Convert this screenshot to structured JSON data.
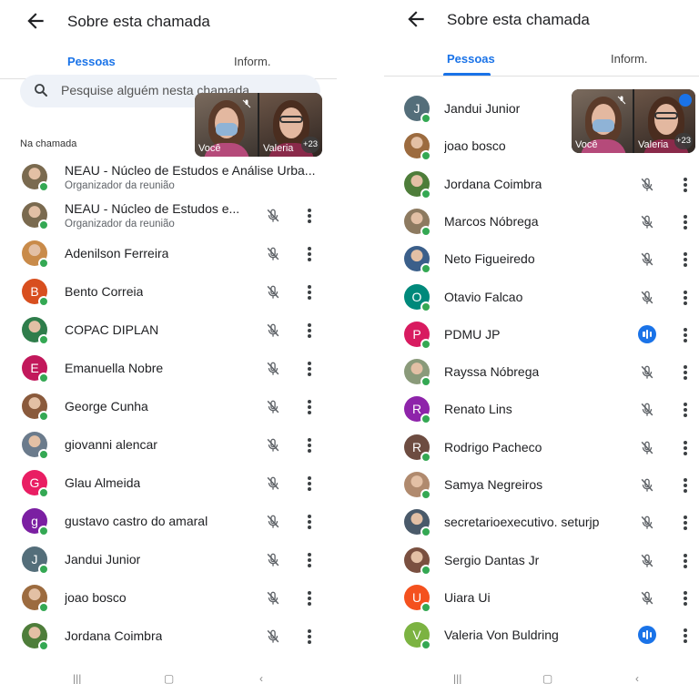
{
  "header": {
    "title": "Sobre esta chamada"
  },
  "tabs": {
    "people": "Pessoas",
    "info": "Inform."
  },
  "search": {
    "placeholder": "Pesquise alguém nesta chamada"
  },
  "section_label": "Na chamada",
  "pip": {
    "you_label": "Você",
    "other_label": "Valeria",
    "extra_count": "+23"
  },
  "left_list": [
    {
      "name": "NEAU - Núcleo de Estudos e Análise Urba...",
      "sub": "Organizador da reunião",
      "avatar": "photo",
      "color": "#7a6a4f",
      "controls": false
    },
    {
      "name": "NEAU - Núcleo de Estudos e...",
      "sub": "Organizador da reunião",
      "avatar": "photo",
      "color": "#7a6a4f",
      "controls": true
    },
    {
      "name": "Adenilson Ferreira",
      "avatar": "photo",
      "color": "#c98b4a",
      "controls": true
    },
    {
      "name": "Bento Correia",
      "avatar": "letter",
      "letter": "B",
      "color": "#d84f1f",
      "controls": true
    },
    {
      "name": "COPAC DIPLAN",
      "avatar": "photo",
      "color": "#2f7d4b",
      "controls": true
    },
    {
      "name": "Emanuella Nobre",
      "avatar": "letter",
      "letter": "E",
      "color": "#c2185b",
      "controls": true
    },
    {
      "name": "George Cunha",
      "avatar": "photo",
      "color": "#8a5a3c",
      "controls": true
    },
    {
      "name": "giovanni alencar",
      "avatar": "photo",
      "color": "#6b7b8c",
      "controls": true
    },
    {
      "name": "Glau Almeida",
      "avatar": "letter",
      "letter": "G",
      "color": "#e91e63",
      "controls": true
    },
    {
      "name": "gustavo castro do amaral",
      "avatar": "letter",
      "letter": "g",
      "color": "#7b1fa2",
      "controls": true
    },
    {
      "name": "Jandui Junior",
      "avatar": "letter",
      "letter": "J",
      "color": "#546e7a",
      "controls": true
    },
    {
      "name": "joao bosco",
      "avatar": "photo",
      "color": "#9c6b3f",
      "controls": true
    },
    {
      "name": "Jordana Coimbra",
      "avatar": "photo",
      "color": "#4e7d3a",
      "controls": true
    }
  ],
  "right_list": [
    {
      "name": "Jandui Junior",
      "avatar": "letter",
      "letter": "J",
      "color": "#546e7a",
      "controls": false
    },
    {
      "name": "joao bosco",
      "avatar": "photo",
      "color": "#9c6b3f",
      "controls": false
    },
    {
      "name": "Jordana Coimbra",
      "avatar": "photo",
      "color": "#4e7d3a",
      "controls": true
    },
    {
      "name": "Marcos Nóbrega",
      "avatar": "photo",
      "color": "#8d7a60",
      "controls": true
    },
    {
      "name": "Neto Figueiredo",
      "avatar": "photo",
      "color": "#3b5f8a",
      "controls": true
    },
    {
      "name": "Otavio Falcao",
      "avatar": "letter",
      "letter": "O",
      "color": "#00897b",
      "controls": true
    },
    {
      "name": "PDMU JP",
      "avatar": "letter",
      "letter": "P",
      "color": "#d81b60",
      "controls": true,
      "speaking": true
    },
    {
      "name": "Rayssa Nóbrega",
      "avatar": "photo",
      "color": "#8a9a7a",
      "controls": true
    },
    {
      "name": "Renato Lins",
      "avatar": "letter",
      "letter": "R",
      "color": "#8e24aa",
      "controls": true
    },
    {
      "name": "Rodrigo Pacheco",
      "avatar": "letter",
      "letter": "R",
      "color": "#6d4c41",
      "controls": true
    },
    {
      "name": "Samya Negreiros",
      "avatar": "photo",
      "color": "#b08a6e",
      "controls": true
    },
    {
      "name": "secretarioexecutivo. seturjp",
      "avatar": "photo",
      "color": "#4a5a6a",
      "controls": true
    },
    {
      "name": "Sergio Dantas Jr",
      "avatar": "photo",
      "color": "#7a5040",
      "controls": true
    },
    {
      "name": "Uiara Ui",
      "avatar": "letter",
      "letter": "U",
      "color": "#f4511e",
      "controls": true
    },
    {
      "name": "Valeria Von Buldring",
      "avatar": "letter",
      "letter": "V",
      "color": "#7cb342",
      "controls": true,
      "speaking": true
    }
  ],
  "colors": {
    "accent": "#1a73e8",
    "presence": "#34a853"
  },
  "icons": [
    "back-arrow-icon",
    "search-icon",
    "mic-off-icon",
    "more-vert-icon",
    "speaking-icon"
  ]
}
